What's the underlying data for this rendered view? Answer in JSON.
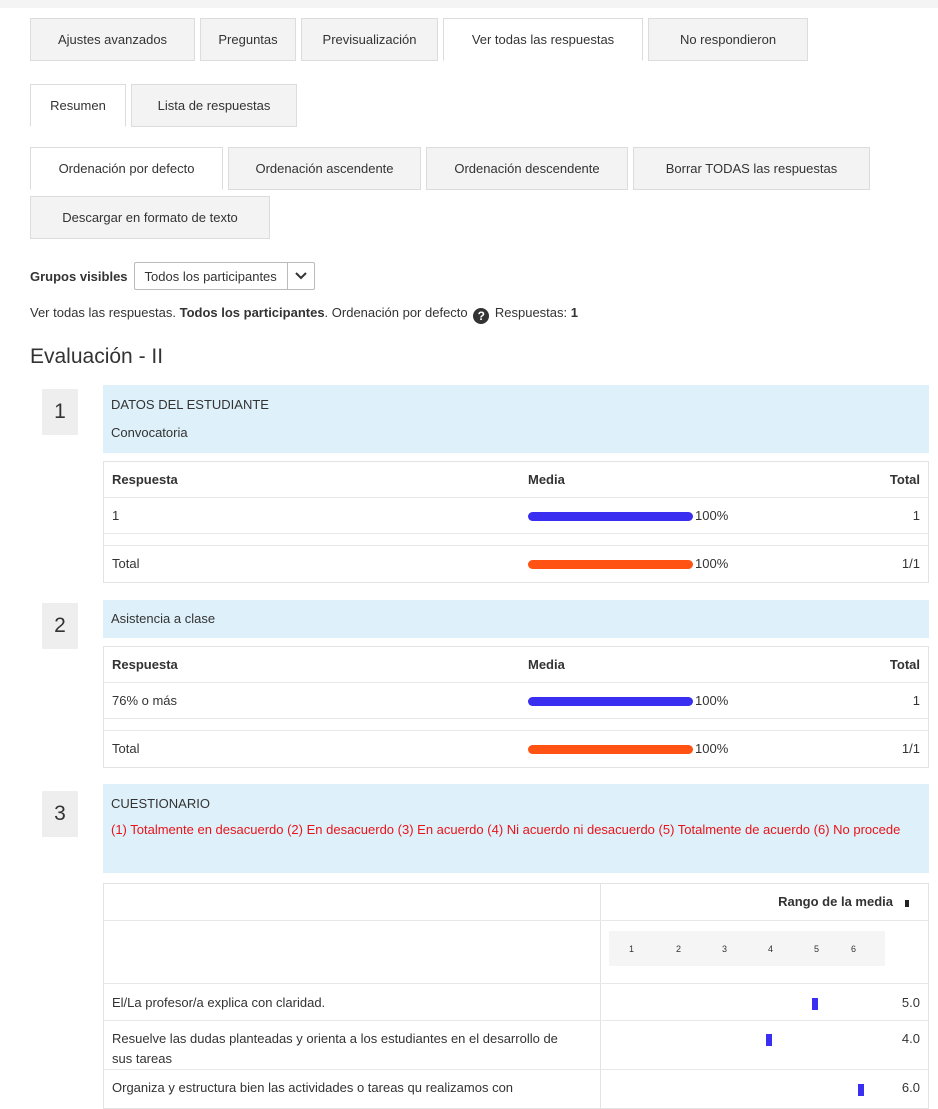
{
  "tabs_main": [
    "Ajustes avanzados",
    "Preguntas",
    "Previsualización",
    "Ver todas las respuestas",
    "No respondieron"
  ],
  "tabs_view": [
    "Resumen",
    "Lista de respuestas"
  ],
  "tabs_order": [
    "Ordenación por defecto",
    "Ordenación ascendente",
    "Ordenación descendente",
    "Borrar TODAS las respuestas"
  ],
  "tab_download": "Descargar en formato de texto",
  "groups": {
    "label": "Grupos visibles",
    "selected": "Todos los participantes"
  },
  "info": {
    "prefix": "Ver todas las respuestas. ",
    "group": "Todos los participantes",
    "order": ". Ordenación por defecto",
    "responses": " Respuestas: ",
    "count": "1"
  },
  "survey_title": "Evaluación - II",
  "colors": {
    "bar_blue": "#3a2ff0",
    "bar_orange": "#ff5213",
    "question_bg": "#def0f9",
    "legend_red": "#e8141a"
  },
  "q1": {
    "number": "1",
    "section": "DATOS DEL ESTUDIANTE",
    "text": "Convocatoria",
    "headers": [
      "Respuesta",
      "Media",
      "Total"
    ],
    "row": {
      "answer": "1",
      "percent": "100%",
      "total": "1"
    },
    "total_row": {
      "label": "Total",
      "percent": "100%",
      "total": "1/1"
    }
  },
  "q2": {
    "number": "2",
    "text": "Asistencia a clase",
    "headers": [
      "Respuesta",
      "Media",
      "Total"
    ],
    "row": {
      "answer": "76% o más",
      "percent": "100%",
      "total": "1"
    },
    "total_row": {
      "label": "Total",
      "percent": "100%",
      "total": "1/1"
    }
  },
  "q3": {
    "number": "3",
    "section": "CUESTIONARIO",
    "legend": "(1) Totalmente en desacuerdo (2) En desacuerdo (3) En acuerdo (4) Ni acuerdo ni desacuerdo (5) Totalmente de acuerdo (6) No procede",
    "range_header": "Rango de la media",
    "scale": [
      "1",
      "2",
      "3",
      "4",
      "5",
      "6"
    ],
    "items": [
      {
        "text": "El/La profesor/a explica con claridad.",
        "mean": "5.0",
        "value": 5
      },
      {
        "text": "Resuelve las dudas planteadas y orienta a los estudiantes en el desarrollo de sus tareas",
        "mean": "4.0",
        "value": 4
      },
      {
        "text": "Organiza y estructura bien las actividades o tareas qu realizamos con",
        "mean": "6.0",
        "value": 6
      }
    ]
  }
}
